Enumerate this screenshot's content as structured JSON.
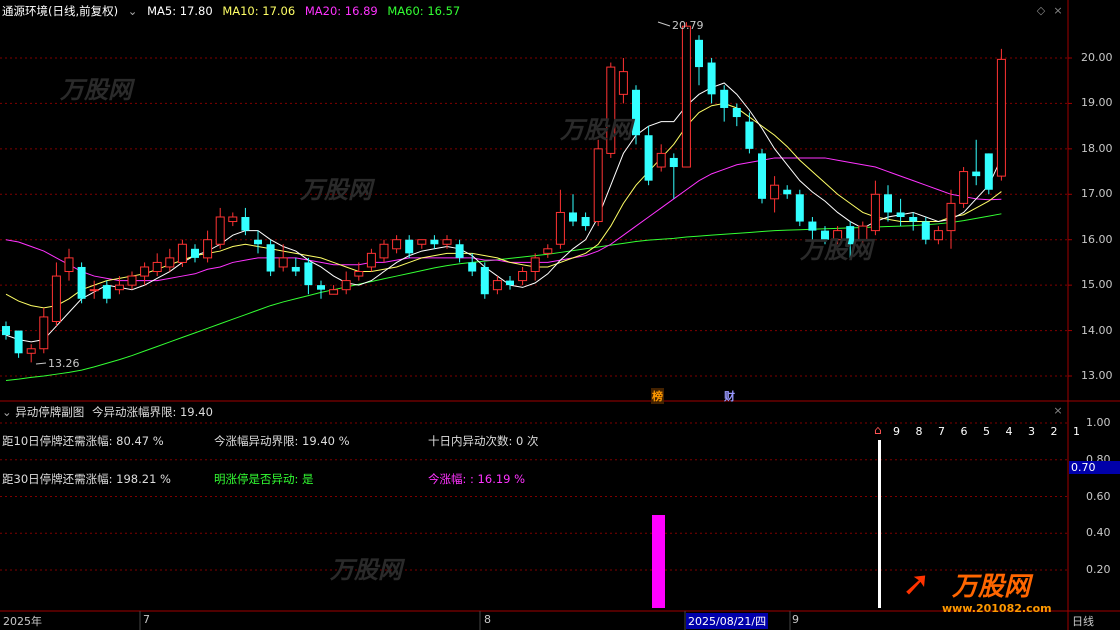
{
  "header": {
    "title": "通源环境(日线,前复权)",
    "ma": [
      {
        "label": "MA5: 17.80",
        "color": "#ffffff"
      },
      {
        "label": "MA10: 17.06",
        "color": "#ffff66"
      },
      {
        "label": "MA20: 16.89",
        "color": "#ff33ff"
      },
      {
        "label": "MA60: 16.57",
        "color": "#33ff33"
      }
    ]
  },
  "price_axis": [
    "20.00",
    "19.00",
    "18.00",
    "17.00",
    "16.00",
    "15.00",
    "14.00",
    "13.00"
  ],
  "annotations": {
    "high": "20.79",
    "low": "13.26"
  },
  "event_markers": {
    "bang": "榜",
    "cai": "财"
  },
  "sub_panel": {
    "title": "异动停牌副图",
    "limit_text": "今异动涨幅界限: 19.40",
    "row1": {
      "a": "距10日停牌还需涨幅: 80.47 %",
      "b": "今涨幅异动界限: 19.40 %",
      "c": "十日内异动次数: 0 次"
    },
    "row2": {
      "a": "距30日停牌还需涨幅: 198.21 %",
      "b": "明涨停是否异动: 是",
      "c": "今涨幅: : 16.19 %"
    },
    "axis": [
      "1.00",
      "0.80",
      "0.60",
      "0.40",
      "0.20"
    ],
    "highlight": "0.70",
    "days": "9 8 7 6 5 4 3 2 1"
  },
  "dates": {
    "year": "2025年",
    "m7": "7",
    "m8": "8",
    "selected": "2025/08/21/四",
    "m9": "9",
    "period": "日线"
  },
  "watermark": {
    "brand": "万股网",
    "url": "www.201082.com"
  },
  "colors": {
    "up": "#ff3333",
    "down": "#33ffff",
    "grid": "#800000",
    "border": "#a00000"
  },
  "chart_data": {
    "type": "candlestick",
    "title": "通源环境(日线,前复权)",
    "ylim": [
      12.7,
      21.0
    ],
    "candles": [
      {
        "o": 14.1,
        "c": 13.9,
        "h": 14.2,
        "l": 13.8
      },
      {
        "o": 14.0,
        "c": 13.5,
        "h": 14.0,
        "l": 13.4
      },
      {
        "o": 13.5,
        "c": 13.6,
        "h": 13.7,
        "l": 13.3
      },
      {
        "o": 13.6,
        "c": 14.3,
        "h": 14.5,
        "l": 13.5
      },
      {
        "o": 14.2,
        "c": 15.2,
        "h": 15.5,
        "l": 14.1
      },
      {
        "o": 15.3,
        "c": 15.6,
        "h": 15.8,
        "l": 15.1
      },
      {
        "o": 15.4,
        "c": 14.7,
        "h": 15.5,
        "l": 14.6
      },
      {
        "o": 14.9,
        "c": 14.9,
        "h": 15.1,
        "l": 14.7
      },
      {
        "o": 15.0,
        "c": 14.7,
        "h": 15.1,
        "l": 14.6
      },
      {
        "o": 14.9,
        "c": 15.0,
        "h": 15.2,
        "l": 14.8
      },
      {
        "o": 15.0,
        "c": 15.2,
        "h": 15.3,
        "l": 14.9
      },
      {
        "o": 15.2,
        "c": 15.4,
        "h": 15.5,
        "l": 15.0
      },
      {
        "o": 15.3,
        "c": 15.5,
        "h": 15.7,
        "l": 15.2
      },
      {
        "o": 15.4,
        "c": 15.6,
        "h": 15.8,
        "l": 15.3
      },
      {
        "o": 15.5,
        "c": 15.9,
        "h": 16.0,
        "l": 15.4
      },
      {
        "o": 15.8,
        "c": 15.6,
        "h": 15.9,
        "l": 15.5
      },
      {
        "o": 15.6,
        "c": 16.0,
        "h": 16.2,
        "l": 15.5
      },
      {
        "o": 15.9,
        "c": 16.5,
        "h": 16.7,
        "l": 15.8
      },
      {
        "o": 16.4,
        "c": 16.5,
        "h": 16.6,
        "l": 16.3
      },
      {
        "o": 16.5,
        "c": 16.2,
        "h": 16.7,
        "l": 16.1
      },
      {
        "o": 16.0,
        "c": 15.9,
        "h": 16.2,
        "l": 15.7
      },
      {
        "o": 15.9,
        "c": 15.3,
        "h": 16.0,
        "l": 15.2
      },
      {
        "o": 15.4,
        "c": 15.6,
        "h": 15.9,
        "l": 15.3
      },
      {
        "o": 15.4,
        "c": 15.3,
        "h": 15.6,
        "l": 15.2
      },
      {
        "o": 15.5,
        "c": 15.0,
        "h": 15.6,
        "l": 14.8
      },
      {
        "o": 15.0,
        "c": 14.9,
        "h": 15.1,
        "l": 14.7
      },
      {
        "o": 14.8,
        "c": 14.9,
        "h": 15.0,
        "l": 14.8
      },
      {
        "o": 14.9,
        "c": 15.1,
        "h": 15.3,
        "l": 14.8
      },
      {
        "o": 15.2,
        "c": 15.3,
        "h": 15.5,
        "l": 15.1
      },
      {
        "o": 15.4,
        "c": 15.7,
        "h": 15.8,
        "l": 15.3
      },
      {
        "o": 15.6,
        "c": 15.9,
        "h": 16.0,
        "l": 15.5
      },
      {
        "o": 15.8,
        "c": 16.0,
        "h": 16.1,
        "l": 15.7
      },
      {
        "o": 16.0,
        "c": 15.7,
        "h": 16.1,
        "l": 15.6
      },
      {
        "o": 15.9,
        "c": 16.0,
        "h": 16.0,
        "l": 15.8
      },
      {
        "o": 16.0,
        "c": 15.9,
        "h": 16.1,
        "l": 15.8
      },
      {
        "o": 15.9,
        "c": 16.0,
        "h": 16.1,
        "l": 15.8
      },
      {
        "o": 15.9,
        "c": 15.6,
        "h": 16.0,
        "l": 15.5
      },
      {
        "o": 15.5,
        "c": 15.3,
        "h": 15.7,
        "l": 15.2
      },
      {
        "o": 15.4,
        "c": 14.8,
        "h": 15.5,
        "l": 14.7
      },
      {
        "o": 14.9,
        "c": 15.1,
        "h": 15.2,
        "l": 14.8
      },
      {
        "o": 15.1,
        "c": 15.0,
        "h": 15.2,
        "l": 14.9
      },
      {
        "o": 15.1,
        "c": 15.3,
        "h": 15.4,
        "l": 15.0
      },
      {
        "o": 15.3,
        "c": 15.6,
        "h": 15.7,
        "l": 15.1
      },
      {
        "o": 15.7,
        "c": 15.8,
        "h": 15.9,
        "l": 15.6
      },
      {
        "o": 15.9,
        "c": 16.6,
        "h": 17.1,
        "l": 15.8
      },
      {
        "o": 16.6,
        "c": 16.4,
        "h": 17.0,
        "l": 16.3
      },
      {
        "o": 16.5,
        "c": 16.3,
        "h": 16.6,
        "l": 16.2
      },
      {
        "o": 16.4,
        "c": 18.0,
        "h": 18.2,
        "l": 16.3
      },
      {
        "o": 17.9,
        "c": 19.8,
        "h": 19.9,
        "l": 17.8
      },
      {
        "o": 19.2,
        "c": 19.7,
        "h": 20.0,
        "l": 19.0
      },
      {
        "o": 19.3,
        "c": 18.3,
        "h": 19.4,
        "l": 18.1
      },
      {
        "o": 18.3,
        "c": 17.3,
        "h": 18.5,
        "l": 17.2
      },
      {
        "o": 17.6,
        "c": 17.9,
        "h": 18.1,
        "l": 17.5
      },
      {
        "o": 17.8,
        "c": 17.6,
        "h": 17.9,
        "l": 16.9
      },
      {
        "o": 17.6,
        "c": 20.7,
        "h": 20.79,
        "l": 17.6
      },
      {
        "o": 20.4,
        "c": 19.8,
        "h": 20.5,
        "l": 19.4
      },
      {
        "o": 19.9,
        "c": 19.2,
        "h": 20.0,
        "l": 19.0
      },
      {
        "o": 19.3,
        "c": 18.9,
        "h": 19.4,
        "l": 18.6
      },
      {
        "o": 18.9,
        "c": 18.7,
        "h": 19.0,
        "l": 18.5
      },
      {
        "o": 18.6,
        "c": 18.0,
        "h": 18.8,
        "l": 17.9
      },
      {
        "o": 17.9,
        "c": 16.9,
        "h": 18.0,
        "l": 16.8
      },
      {
        "o": 16.9,
        "c": 17.2,
        "h": 17.4,
        "l": 16.6
      },
      {
        "o": 17.1,
        "c": 17.0,
        "h": 17.2,
        "l": 16.9
      },
      {
        "o": 17.0,
        "c": 16.4,
        "h": 17.1,
        "l": 16.3
      },
      {
        "o": 16.4,
        "c": 16.2,
        "h": 16.5,
        "l": 16.0
      },
      {
        "o": 16.2,
        "c": 16.0,
        "h": 16.3,
        "l": 15.9
      },
      {
        "o": 16.0,
        "c": 16.2,
        "h": 16.3,
        "l": 15.9
      },
      {
        "o": 16.3,
        "c": 15.9,
        "h": 16.4,
        "l": 15.6
      },
      {
        "o": 16.0,
        "c": 16.3,
        "h": 16.4,
        "l": 15.9
      },
      {
        "o": 16.2,
        "c": 17.0,
        "h": 17.3,
        "l": 16.1
      },
      {
        "o": 17.0,
        "c": 16.6,
        "h": 17.2,
        "l": 16.4
      },
      {
        "o": 16.6,
        "c": 16.5,
        "h": 16.9,
        "l": 16.3
      },
      {
        "o": 16.5,
        "c": 16.4,
        "h": 16.6,
        "l": 16.2
      },
      {
        "o": 16.4,
        "c": 16.0,
        "h": 16.5,
        "l": 15.9
      },
      {
        "o": 16.0,
        "c": 16.2,
        "h": 16.3,
        "l": 15.9
      },
      {
        "o": 16.2,
        "c": 16.8,
        "h": 17.1,
        "l": 15.8
      },
      {
        "o": 16.8,
        "c": 17.5,
        "h": 17.6,
        "l": 16.7
      },
      {
        "o": 17.5,
        "c": 17.4,
        "h": 18.2,
        "l": 17.2
      },
      {
        "o": 17.9,
        "c": 17.1,
        "h": 17.9,
        "l": 17.0
      },
      {
        "o": 17.4,
        "c": 19.97,
        "h": 20.2,
        "l": 17.3
      }
    ],
    "ma5": [
      13.9,
      13.8,
      13.75,
      13.8,
      14.1,
      14.4,
      14.7,
      14.85,
      15.0,
      14.95,
      14.9,
      15.0,
      15.15,
      15.3,
      15.5,
      15.65,
      15.75,
      15.9,
      16.1,
      16.2,
      16.2,
      16.0,
      15.85,
      15.75,
      15.55,
      15.4,
      15.2,
      15.05,
      15.0,
      15.1,
      15.3,
      15.5,
      15.65,
      15.75,
      15.8,
      15.85,
      15.8,
      15.65,
      15.4,
      15.2,
      15.0,
      14.95,
      15.05,
      15.25,
      15.55,
      15.8,
      16.0,
      16.5,
      17.2,
      17.9,
      18.3,
      18.5,
      18.6,
      18.6,
      18.95,
      19.2,
      19.35,
      19.45,
      19.2,
      18.85,
      18.45,
      18.0,
      17.65,
      17.3,
      17.05,
      16.85,
      16.6,
      16.4,
      16.25,
      16.4,
      16.5,
      16.55,
      16.6,
      16.5,
      16.4,
      16.45,
      16.6,
      16.9,
      17.2,
      17.8
    ],
    "ma10": [
      14.8,
      14.65,
      14.55,
      14.5,
      14.55,
      14.7,
      14.9,
      15.0,
      15.1,
      15.15,
      15.2,
      15.25,
      15.35,
      15.45,
      15.55,
      15.65,
      15.7,
      15.75,
      15.85,
      15.9,
      15.85,
      15.8,
      15.75,
      15.7,
      15.65,
      15.6,
      15.5,
      15.4,
      15.3,
      15.3,
      15.35,
      15.4,
      15.5,
      15.6,
      15.65,
      15.7,
      15.7,
      15.7,
      15.65,
      15.6,
      15.5,
      15.45,
      15.4,
      15.4,
      15.5,
      15.6,
      15.7,
      15.9,
      16.3,
      16.8,
      17.2,
      17.5,
      17.8,
      18.1,
      18.5,
      18.8,
      18.95,
      19.0,
      18.9,
      18.7,
      18.5,
      18.3,
      18.05,
      17.75,
      17.5,
      17.25,
      17.0,
      16.8,
      16.6,
      16.5,
      16.45,
      16.4,
      16.4,
      16.4,
      16.4,
      16.5,
      16.55,
      16.7,
      16.85,
      17.06
    ],
    "ma20": [
      16.0,
      15.95,
      15.85,
      15.75,
      15.6,
      15.45,
      15.3,
      15.2,
      15.15,
      15.1,
      15.1,
      15.1,
      15.1,
      15.15,
      15.2,
      15.25,
      15.35,
      15.4,
      15.5,
      15.55,
      15.6,
      15.6,
      15.6,
      15.6,
      15.55,
      15.5,
      15.45,
      15.45,
      15.45,
      15.5,
      15.5,
      15.55,
      15.6,
      15.6,
      15.6,
      15.6,
      15.6,
      15.6,
      15.55,
      15.55,
      15.5,
      15.5,
      15.5,
      15.5,
      15.55,
      15.6,
      15.65,
      15.75,
      15.9,
      16.1,
      16.3,
      16.5,
      16.7,
      16.9,
      17.1,
      17.3,
      17.45,
      17.55,
      17.65,
      17.7,
      17.75,
      17.8,
      17.8,
      17.8,
      17.8,
      17.8,
      17.75,
      17.7,
      17.65,
      17.6,
      17.5,
      17.4,
      17.3,
      17.2,
      17.1,
      17.0,
      16.95,
      16.9,
      16.88,
      16.89
    ],
    "ma60": [
      12.9,
      12.93,
      12.97,
      13.0,
      13.04,
      13.08,
      13.13,
      13.2,
      13.28,
      13.36,
      13.45,
      13.55,
      13.65,
      13.75,
      13.85,
      13.95,
      14.05,
      14.15,
      14.25,
      14.35,
      14.45,
      14.55,
      14.63,
      14.7,
      14.77,
      14.84,
      14.9,
      14.96,
      15.02,
      15.08,
      15.14,
      15.2,
      15.26,
      15.32,
      15.38,
      15.43,
      15.47,
      15.5,
      15.53,
      15.56,
      15.59,
      15.62,
      15.65,
      15.68,
      15.72,
      15.76,
      15.8,
      15.84,
      15.88,
      15.92,
      15.96,
      15.99,
      16.01,
      16.03,
      16.06,
      16.08,
      16.1,
      16.12,
      16.14,
      16.16,
      16.18,
      16.2,
      16.21,
      16.22,
      16.23,
      16.24,
      16.25,
      16.26,
      16.27,
      16.28,
      16.29,
      16.3,
      16.31,
      16.33,
      16.35,
      16.38,
      16.42,
      16.47,
      16.52,
      16.57
    ]
  }
}
